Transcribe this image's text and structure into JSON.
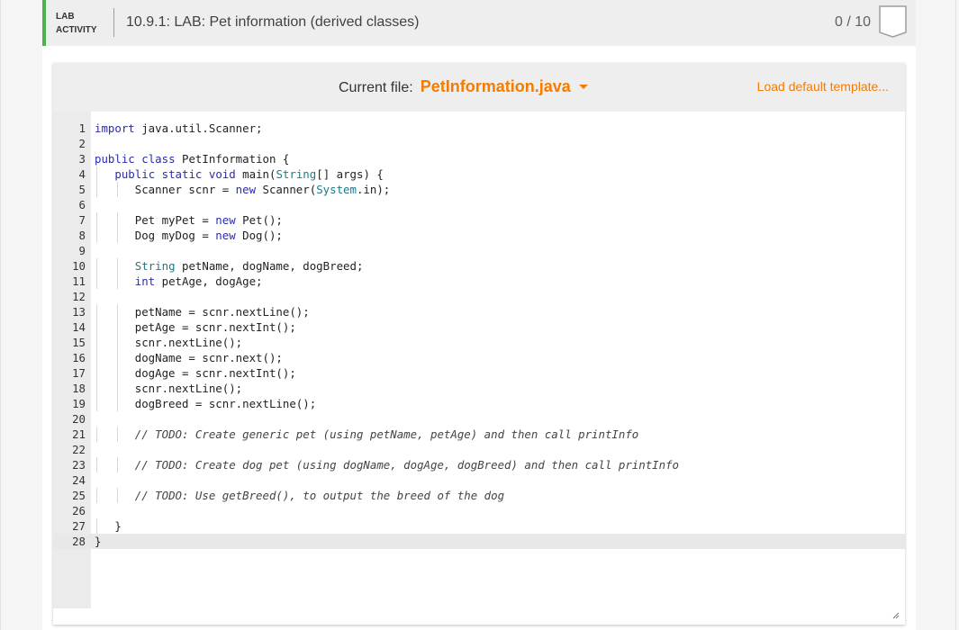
{
  "header": {
    "label_line1": "LAB",
    "label_line2": "ACTIVITY",
    "title": "10.9.1: LAB: Pet information (derived classes)",
    "score": "0 / 10"
  },
  "toolbar": {
    "current_file_label": "Current file:",
    "file_name": "PetInformation.java",
    "load_template": "Load default template..."
  },
  "code": {
    "active_line": 28,
    "lines": [
      "import java.util.Scanner;",
      "",
      "public class PetInformation {",
      "   public static void main(String[] args) {",
      "      Scanner scnr = new Scanner(System.in);",
      "",
      "      Pet myPet = new Pet();",
      "      Dog myDog = new Dog();",
      "",
      "      String petName, dogName, dogBreed;",
      "      int petAge, dogAge;",
      "",
      "      petName = scnr.nextLine();",
      "      petAge = scnr.nextInt();",
      "      scnr.nextLine();",
      "      dogName = scnr.next();",
      "      dogAge = scnr.nextInt();",
      "      scnr.nextLine();",
      "      dogBreed = scnr.nextLine();",
      "",
      "      // TODO: Create generic pet (using petName, petAge) and then call printInfo",
      "",
      "      // TODO: Create dog pet (using dogName, dogAge, dogBreed) and then call printInfo",
      "",
      "      // TODO: Use getBreed(), to output the breed of the dog",
      "",
      "   }",
      "}"
    ]
  },
  "colors": {
    "accent": "#f57c00",
    "activity_bar": "#4caf50",
    "keyword": "#2b2baf",
    "type": "#1a7a8a"
  }
}
